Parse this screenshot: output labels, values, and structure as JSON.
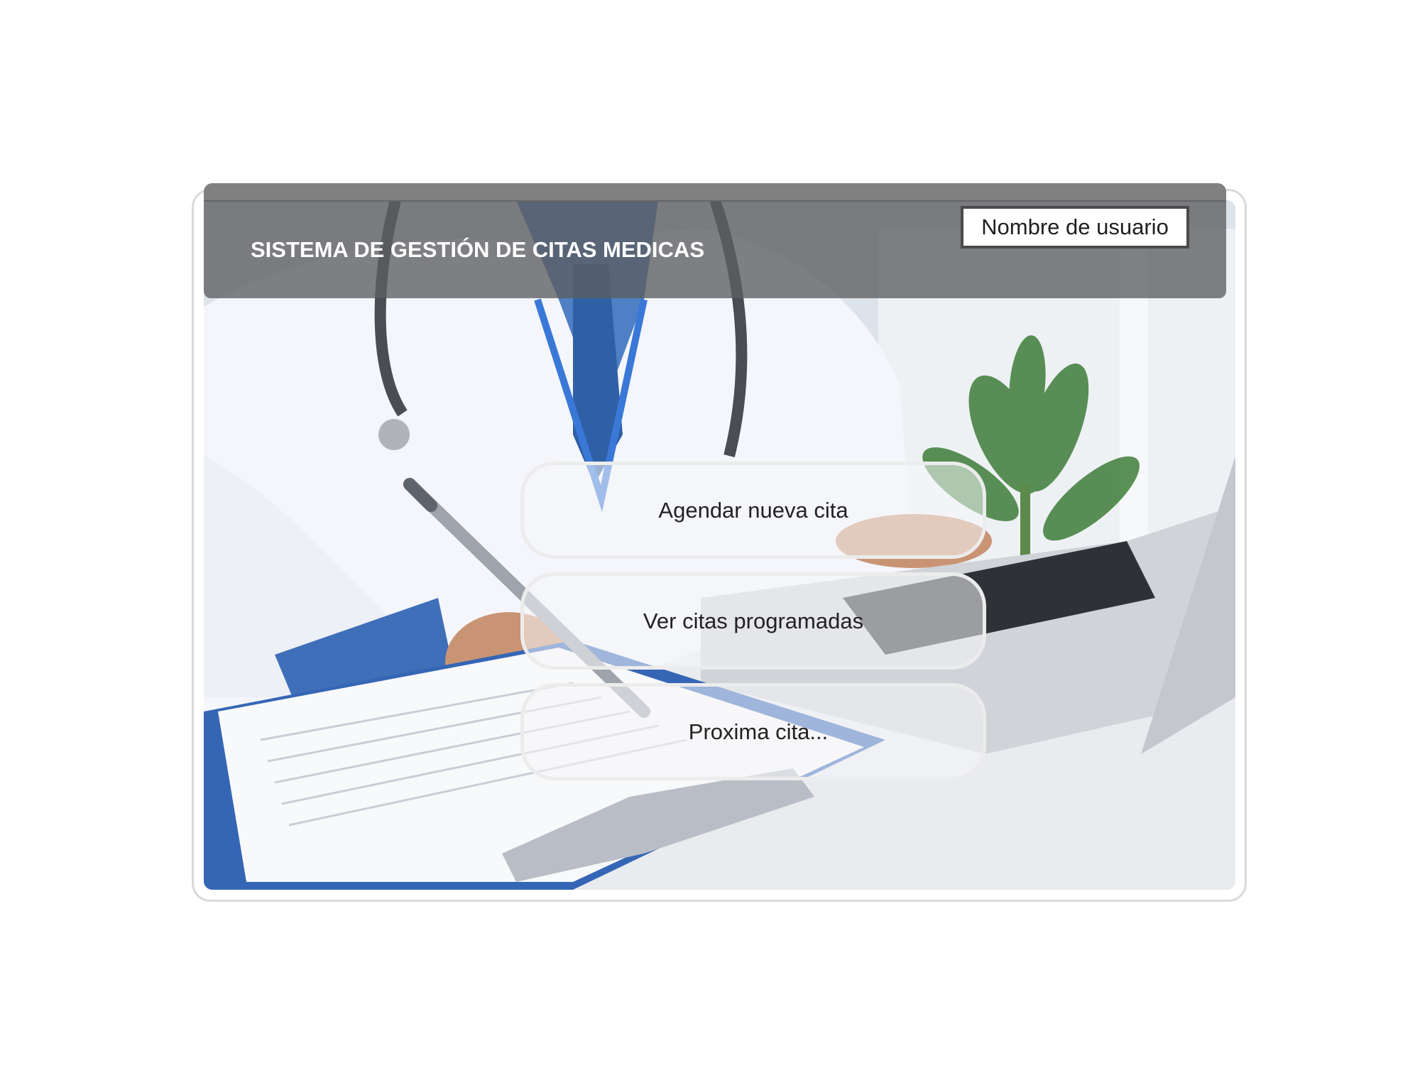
{
  "header": {
    "title": "SISTEMA DE GESTIÓN DE CITAS MEDICAS",
    "username_label": "Nombre de usuario"
  },
  "menu": {
    "items": [
      {
        "label": "Agendar nueva cita"
      },
      {
        "label": "Ver citas programadas"
      },
      {
        "label": "Proxima cita..."
      }
    ]
  },
  "background": {
    "subject": "doctor-at-desk-photo"
  },
  "colors": {
    "header_bg": "#5c5e60",
    "header_text": "#ffffff",
    "button_border": "#ececec",
    "button_text": "#222222"
  }
}
